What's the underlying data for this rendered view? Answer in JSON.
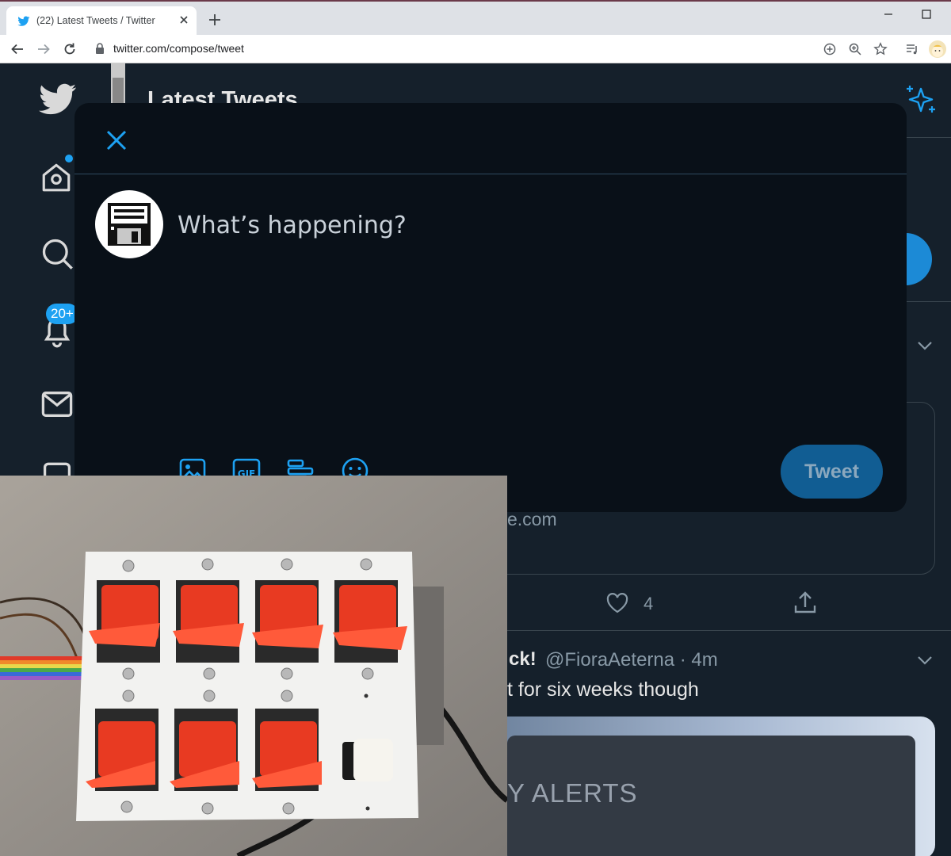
{
  "browser": {
    "tab_title": "(22) Latest Tweets / Twitter",
    "url": "twitter.com/compose/tweet"
  },
  "twitter": {
    "page_title": "Latest Tweets",
    "notification_badge": "20+",
    "card_domain": "e.com",
    "like_count": "4",
    "tweet_name_fragment": "ck!",
    "tweet_meta": "@FioraAeterna · 4m",
    "tweet_text_fragment": "t for six weeks though",
    "media_text_fragment": "Y ALERTS"
  },
  "compose": {
    "placeholder": "What’s happening?",
    "tweet_button": "Tweet"
  },
  "colors": {
    "twitter_blue": "#1da1f2",
    "background": "#15202b",
    "modal": "#091018",
    "switch_red": "#e83a22"
  }
}
